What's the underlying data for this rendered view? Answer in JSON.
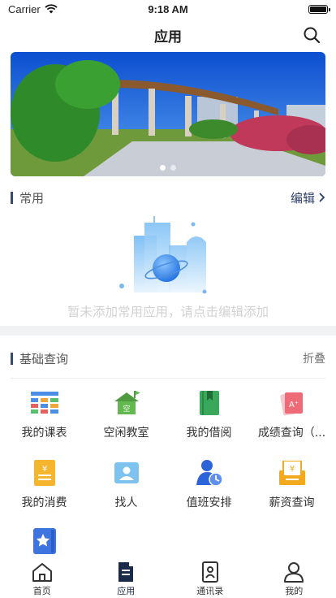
{
  "status_bar": {
    "carrier": "Carrier",
    "time": "9:18 AM",
    "battery_level": 1.0
  },
  "nav": {
    "title": "应用"
  },
  "banner": {
    "slide_count": 2,
    "active_slide": 0
  },
  "common": {
    "title": "常用",
    "edit_label": "编辑",
    "empty_message": "暂未添加常用应用，请点击编辑添加"
  },
  "basic": {
    "title": "基础查询",
    "fold_label": "折叠"
  },
  "apps": [
    {
      "label": "我的课表",
      "icon": "timetable-icon"
    },
    {
      "label": "空闲教室",
      "icon": "classroom-icon"
    },
    {
      "label": "我的借阅",
      "icon": "book-icon"
    },
    {
      "label": "成绩查询（...",
      "icon": "grade-icon"
    },
    {
      "label": "我的消费",
      "icon": "consumption-icon"
    },
    {
      "label": "找人",
      "icon": "find-person-icon"
    },
    {
      "label": "值班安排",
      "icon": "duty-schedule-icon"
    },
    {
      "label": "薪资查询",
      "icon": "salary-icon"
    },
    {
      "label": "",
      "icon": "star-card-icon"
    }
  ],
  "tabs": [
    {
      "label": "首页",
      "icon": "home-icon"
    },
    {
      "label": "应用",
      "icon": "apps-icon",
      "active": true
    },
    {
      "label": "通讯录",
      "icon": "contacts-icon"
    },
    {
      "label": "我的",
      "icon": "profile-icon"
    }
  ],
  "colors": {
    "accent": "#1c2a4a",
    "section_bar": "#3b4a6b",
    "separator": "#f1f2f4"
  }
}
